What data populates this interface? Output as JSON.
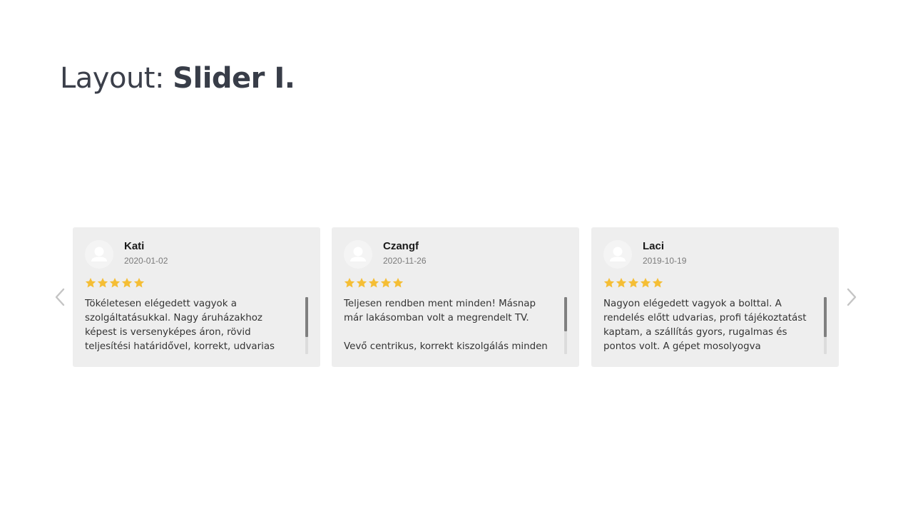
{
  "header": {
    "title_prefix": "Layout:",
    "title_strong": "Slider I."
  },
  "slider": {
    "prev_icon": "chevron-left-icon",
    "next_icon": "chevron-right-icon",
    "star_color": "#f5be35",
    "reviews": [
      {
        "name": "Kati",
        "date": "2020-01-02",
        "rating": 5,
        "text": "Tökéletesen elégedett vagyok a szolgáltatásukkal. Nagy áruházakhoz képest is versenyképes áron, rövid teljesítési határidővel, korrekt, udvarias",
        "scroll_position": 0
      },
      {
        "name": "Czangf",
        "date": "2020-11-26",
        "rating": 5,
        "text": "Teljesen rendben ment minden! Másnap már lakásomban volt a megrendelt TV.\n\nVevő centrikus, korrekt kiszolgálás minden",
        "scroll_position": 0
      },
      {
        "name": "Laci",
        "date": "2019-10-19",
        "rating": 5,
        "text": "Nagyon elégedett vagyok a bolttal. A rendelés előtt udvarias, profi tájékoztatást kaptam, a szállítás gyors, rugalmas és pontos volt. A gépet mosolyogva kicsomagolták, helyére",
        "scroll_position": 0
      }
    ]
  }
}
